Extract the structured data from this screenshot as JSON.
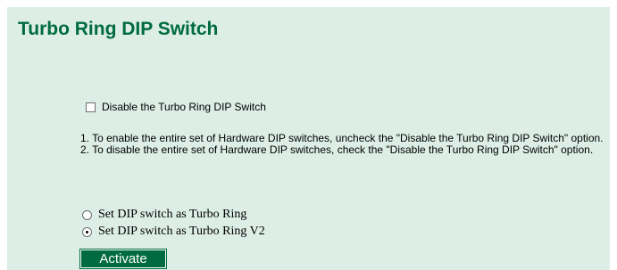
{
  "page": {
    "title": "Turbo Ring DIP Switch"
  },
  "disable_option": {
    "label": "Disable the Turbo Ring DIP Switch",
    "checked": false
  },
  "instructions": {
    "line1": "1. To enable the entire set of Hardware DIP switches, uncheck the \"Disable the Turbo Ring DIP Switch\" option.",
    "line2": "2. To disable the entire set of Hardware DIP switches, check the \"Disable the Turbo Ring DIP Switch\" option."
  },
  "mode_options": [
    {
      "label": "Set DIP switch as Turbo Ring",
      "selected": false
    },
    {
      "label": "Set DIP switch as Turbo Ring V2",
      "selected": true
    }
  ],
  "actions": {
    "activate_label": "Activate"
  },
  "colors": {
    "panel_background": "#dceee6",
    "title": "#006b3f",
    "button_background": "#006b3f",
    "button_text": "#ffffff"
  }
}
